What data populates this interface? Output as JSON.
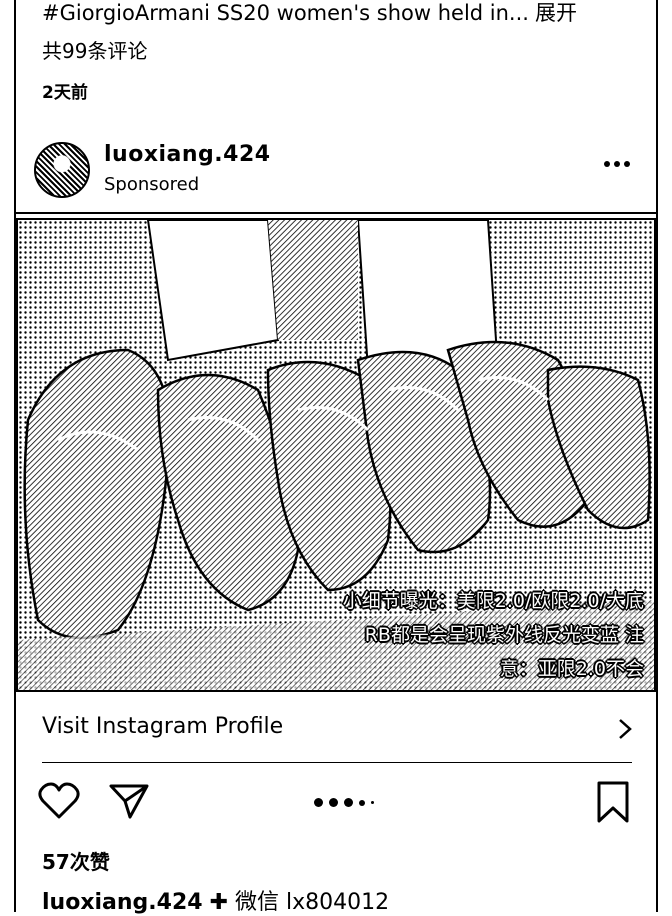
{
  "previous_post": {
    "caption": "#GiorgioArmani SS20 women's show held in...",
    "expand_label": "展开",
    "comments": "共99条评论",
    "time": "2天前"
  },
  "post": {
    "username": "luoxiang.424",
    "sponsored": "Sponsored",
    "more_icon": "more-horizontal-icon",
    "image_caption": "小细节曝光：美限2.0/欧限2.0/大底\nRB都是会呈现紫外线反光变蓝 注\n意：亚限2.0不会",
    "visit_profile": "Visit Instagram Profile",
    "likes": "57次赞",
    "caption_user": "luoxiang.424",
    "caption_text": "✚ 微信 lx804012",
    "carousel_count": 5,
    "carousel_active": 0
  },
  "icons": {
    "like": "heart-icon",
    "share": "send-icon",
    "save": "bookmark-icon",
    "visit": "chevron-right-icon"
  }
}
